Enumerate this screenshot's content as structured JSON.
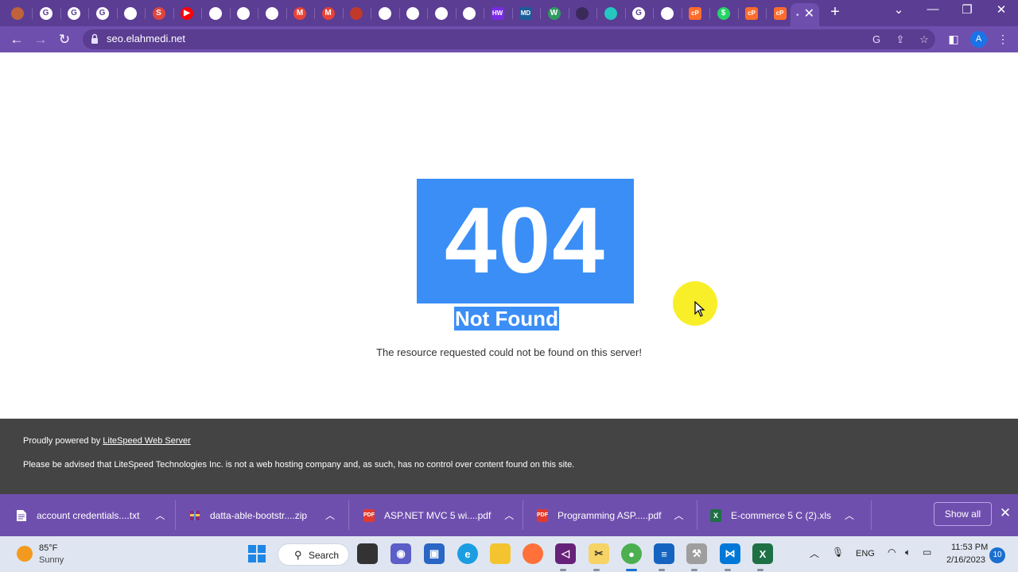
{
  "browser": {
    "address": "seo.elahmedi.net",
    "favicons": [
      {
        "icon": "stripe-favicon-icon",
        "color": "#c0623b",
        "glyph": ""
      },
      {
        "icon": "google-favicon-icon",
        "color": "#ffffff",
        "glyph": "G"
      },
      {
        "icon": "google-favicon-icon",
        "color": "#ffffff",
        "glyph": "G"
      },
      {
        "icon": "google-favicon-icon",
        "color": "#ffffff",
        "glyph": "G"
      },
      {
        "icon": "globe-favicon-icon",
        "color": "#ffffff",
        "glyph": ""
      },
      {
        "icon": "s-app-favicon-icon",
        "color": "#e2453c",
        "glyph": "S"
      },
      {
        "icon": "youtube-favicon-icon",
        "color": "#ff0000",
        "glyph": "▶"
      },
      {
        "icon": "globe-favicon-icon",
        "color": "#ffffff",
        "glyph": ""
      },
      {
        "icon": "globe-favicon-icon",
        "color": "#ffffff",
        "glyph": ""
      },
      {
        "icon": "globe-favicon-icon",
        "color": "#ffffff",
        "glyph": ""
      },
      {
        "icon": "gmail-favicon-icon",
        "color": "#ea4335",
        "glyph": "M"
      },
      {
        "icon": "gmail-favicon-icon",
        "color": "#ea4335",
        "glyph": "M"
      },
      {
        "icon": "app-favicon-icon",
        "color": "#c0392b",
        "glyph": ""
      },
      {
        "icon": "chatgpt-favicon-icon",
        "color": "#ffffff",
        "glyph": ""
      },
      {
        "icon": "globe-favicon-icon",
        "color": "#ffffff",
        "glyph": ""
      },
      {
        "icon": "globe-favicon-icon",
        "color": "#ffffff",
        "glyph": ""
      },
      {
        "icon": "globe-favicon-icon",
        "color": "#ffffff",
        "glyph": ""
      },
      {
        "icon": "hw-favicon-icon",
        "color": "#7a2be2",
        "glyph": "HW"
      },
      {
        "icon": "md-favicon-icon",
        "color": "#1c5d99",
        "glyph": "MD"
      },
      {
        "icon": "w-favicon-icon",
        "color": "#2e9b5f",
        "glyph": "W"
      },
      {
        "icon": "github-favicon-icon",
        "color": "#3a2a5a",
        "glyph": ""
      },
      {
        "icon": "app-favicon-icon",
        "color": "#25c7c1",
        "glyph": ""
      },
      {
        "icon": "google-favicon-icon",
        "color": "#ffffff",
        "glyph": "G"
      },
      {
        "icon": "globe-favicon-icon",
        "color": "#ffffff",
        "glyph": ""
      },
      {
        "icon": "cpanel-favicon-icon",
        "color": "#ff6c2c",
        "glyph": "cP"
      },
      {
        "icon": "whatsapp-favicon-icon",
        "color": "#25d366",
        "glyph": "$"
      },
      {
        "icon": "cpanel-favicon-icon",
        "color": "#ff6c2c",
        "glyph": "cP"
      },
      {
        "icon": "cpanel-favicon-icon",
        "color": "#ff6c2c",
        "glyph": "cP"
      }
    ]
  },
  "page": {
    "code": "404",
    "heading": "Not Found",
    "message": "The resource requested could not be found on this server!"
  },
  "footer": {
    "powered_prefix": "Proudly powered by",
    "powered_link": "LiteSpeed Web Server",
    "notice": "Please be advised that LiteSpeed Technologies Inc. is not a web hosting company and, as such, has no control over content found on this site."
  },
  "downloads": {
    "items": [
      {
        "name": "account credentials....txt",
        "icon": "text-file-icon"
      },
      {
        "name": "datta-able-bootstr....zip",
        "icon": "zip-archive-icon"
      },
      {
        "name": "ASP.NET MVC 5 wi....pdf",
        "icon": "pdf-file-icon"
      },
      {
        "name": "Programming ASP.....pdf",
        "icon": "pdf-file-icon"
      },
      {
        "name": "E-commerce 5 C (2).xls",
        "icon": "excel-file-icon"
      }
    ],
    "show_all": "Show all"
  },
  "taskbar": {
    "temperature": "85°F",
    "weather": "Sunny",
    "search": "Search",
    "language": "ENG",
    "time": "11:53 PM",
    "date": "2/16/2023",
    "notifications": "10"
  },
  "colors": {
    "accent_404": "#3a8ef6",
    "browser_frame": "#6f4fae",
    "footer_bg": "#444444"
  }
}
